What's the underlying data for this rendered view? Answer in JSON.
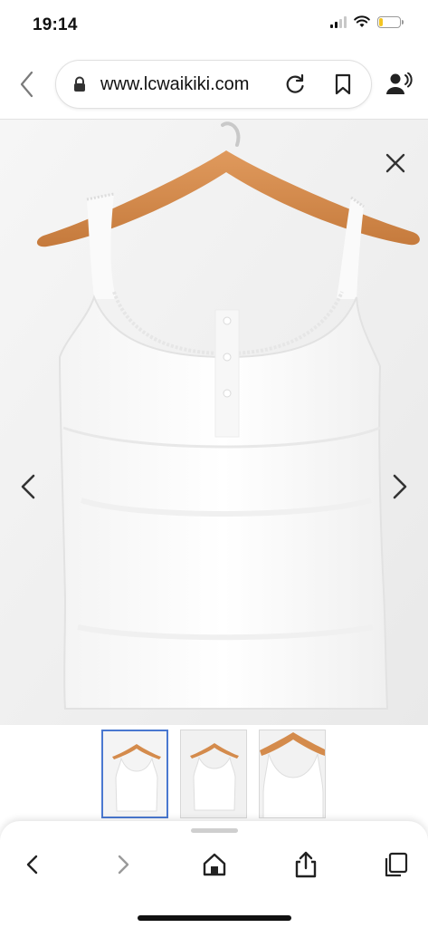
{
  "status_bar": {
    "time": "19:14",
    "icons": [
      "cellular-signal-icon",
      "wifi-icon",
      "battery-icon"
    ],
    "battery_level": 0.2,
    "battery_color": "#f3c522"
  },
  "browser": {
    "url": "www.lcwaikiki.com",
    "icons": [
      "back-chevron-icon",
      "lock-icon",
      "reload-icon",
      "bookmark-icon",
      "account-voice-icon"
    ]
  },
  "viewer": {
    "icons": [
      "close-icon",
      "chevron-left-icon",
      "chevron-right-icon"
    ],
    "background": "#efefef"
  },
  "thumbnails": {
    "count": 3,
    "selected_index": 0,
    "selected_border": "#4a78d0"
  },
  "toolbar": {
    "icons": [
      "back-icon",
      "forward-icon",
      "home-icon",
      "share-icon",
      "tabs-icon"
    ]
  }
}
